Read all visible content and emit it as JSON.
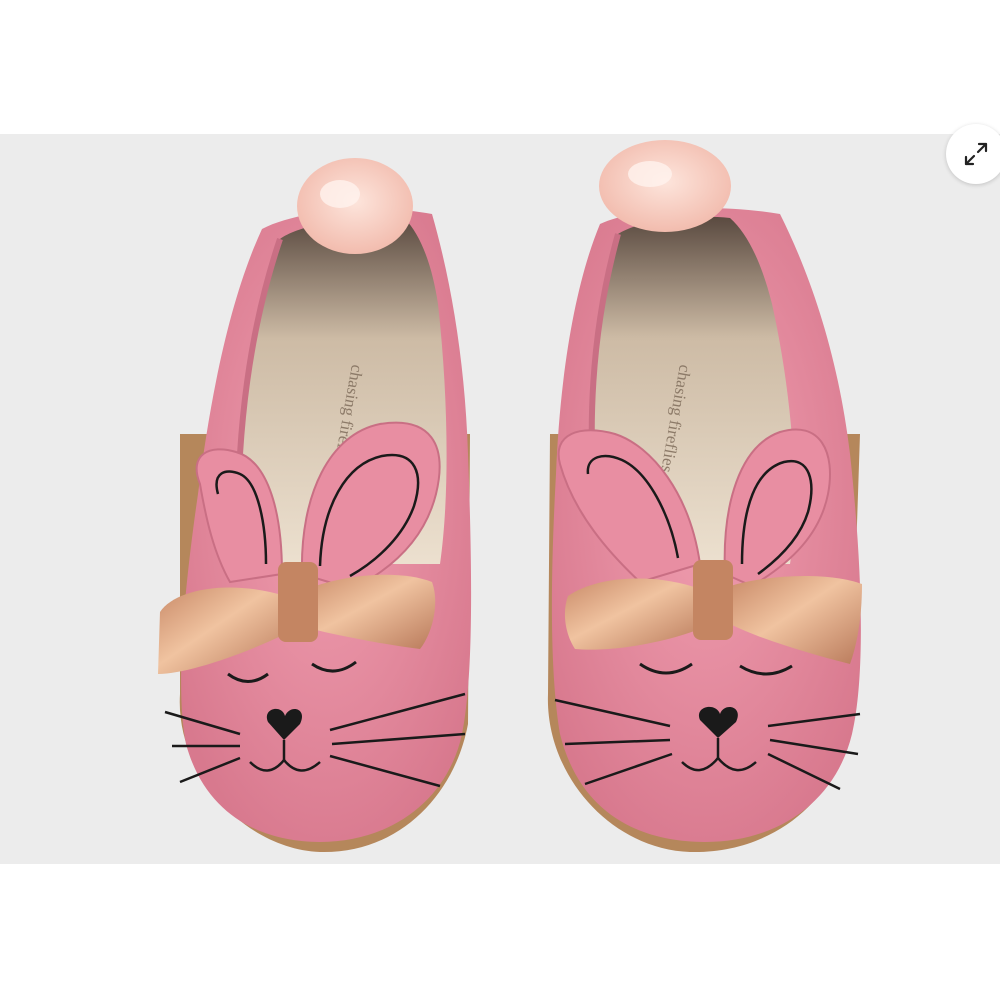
{
  "viewer": {
    "expand_icon": "expand-arrows-icon",
    "background_color": "#ffffff",
    "photo_background_color": "#ececec"
  },
  "product_photo": {
    "colors": {
      "shoe_pink": "#e58da0",
      "shoe_pink_dark": "#c96f84",
      "insole": "#e9dcc9",
      "pompom": "#f6cfc4",
      "bow_gold": "#d7a07a",
      "sole": "#b5875b",
      "embroidery": "#1a1a1a"
    },
    "insole_logo_left": "chasing fireflies",
    "insole_logo_right": "chasing fireflies"
  }
}
